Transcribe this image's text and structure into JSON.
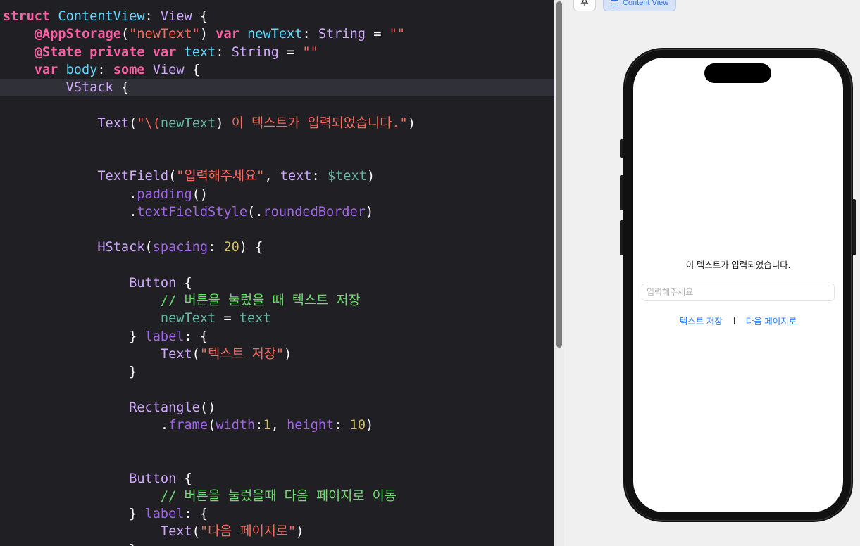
{
  "editor": {
    "lines": [
      [
        [
          "kw",
          "struct"
        ],
        [
          "p",
          " "
        ],
        [
          "def",
          "ContentView"
        ],
        [
          "p",
          ": "
        ],
        [
          "typ",
          "View"
        ],
        [
          "p",
          " {"
        ]
      ],
      [
        [
          "p",
          "    "
        ],
        [
          "kw",
          "@AppStorage"
        ],
        [
          "p",
          "("
        ],
        [
          "str",
          "\"newText\""
        ],
        [
          "p",
          ") "
        ],
        [
          "kw",
          "var"
        ],
        [
          "p",
          " "
        ],
        [
          "def",
          "newText"
        ],
        [
          "p",
          ": "
        ],
        [
          "typ",
          "String"
        ],
        [
          "p",
          " = "
        ],
        [
          "str",
          "\"\""
        ]
      ],
      [
        [
          "p",
          "    "
        ],
        [
          "kw",
          "@State"
        ],
        [
          "p",
          " "
        ],
        [
          "kw",
          "private"
        ],
        [
          "p",
          " "
        ],
        [
          "kw",
          "var"
        ],
        [
          "p",
          " "
        ],
        [
          "def",
          "text"
        ],
        [
          "p",
          ": "
        ],
        [
          "typ",
          "String"
        ],
        [
          "p",
          " = "
        ],
        [
          "str",
          "\"\""
        ]
      ],
      [
        [
          "p",
          "    "
        ],
        [
          "kw",
          "var"
        ],
        [
          "p",
          " "
        ],
        [
          "def",
          "body"
        ],
        [
          "p",
          ": "
        ],
        [
          "kw",
          "some"
        ],
        [
          "p",
          " "
        ],
        [
          "typ",
          "View"
        ],
        [
          "p",
          " {"
        ]
      ],
      [
        [
          "p",
          "        "
        ],
        [
          "typ",
          "VStack"
        ],
        [
          "p",
          " {"
        ]
      ],
      [],
      [
        [
          "p",
          "            "
        ],
        [
          "typ",
          "Text"
        ],
        [
          "p",
          "("
        ],
        [
          "str",
          "\"\\("
        ],
        [
          "var",
          "newText"
        ],
        [
          "p",
          ")"
        ],
        [
          "str",
          " 이 텍스트가 입력되었습니다.\""
        ],
        [
          "p",
          ")"
        ]
      ],
      [],
      [],
      [
        [
          "p",
          "            "
        ],
        [
          "typ",
          "TextField"
        ],
        [
          "p",
          "("
        ],
        [
          "str",
          "\"입력해주세요\""
        ],
        [
          "p",
          ", "
        ],
        [
          "typ",
          "text"
        ],
        [
          "p",
          ": "
        ],
        [
          "var",
          "$text"
        ],
        [
          "p",
          ")"
        ]
      ],
      [
        [
          "p",
          "                ."
        ],
        [
          "mth",
          "padding"
        ],
        [
          "p",
          "()"
        ]
      ],
      [
        [
          "p",
          "                ."
        ],
        [
          "mth",
          "textFieldStyle"
        ],
        [
          "p",
          "(."
        ],
        [
          "mth",
          "roundedBorder"
        ],
        [
          "p",
          ")"
        ]
      ],
      [],
      [
        [
          "p",
          "            "
        ],
        [
          "typ",
          "HStack"
        ],
        [
          "p",
          "("
        ],
        [
          "mth",
          "spacing"
        ],
        [
          "p",
          ": "
        ],
        [
          "num",
          "20"
        ],
        [
          "p",
          ") {"
        ]
      ],
      [],
      [
        [
          "p",
          "                "
        ],
        [
          "typ",
          "Button"
        ],
        [
          "p",
          " {"
        ]
      ],
      [
        [
          "p",
          "                    "
        ],
        [
          "cmt",
          "// 버튼을 눌렀을 때 텍스트 저장"
        ]
      ],
      [
        [
          "p",
          "                    "
        ],
        [
          "var",
          "newText"
        ],
        [
          "p",
          " = "
        ],
        [
          "var",
          "text"
        ]
      ],
      [
        [
          "p",
          "                } "
        ],
        [
          "mth",
          "label"
        ],
        [
          "p",
          ": {"
        ]
      ],
      [
        [
          "p",
          "                    "
        ],
        [
          "typ",
          "Text"
        ],
        [
          "p",
          "("
        ],
        [
          "str",
          "\"텍스트 저장\""
        ],
        [
          "p",
          ")"
        ]
      ],
      [
        [
          "p",
          "                }"
        ]
      ],
      [],
      [
        [
          "p",
          "                "
        ],
        [
          "typ",
          "Rectangle"
        ],
        [
          "p",
          "()"
        ]
      ],
      [
        [
          "p",
          "                    ."
        ],
        [
          "mth",
          "frame"
        ],
        [
          "p",
          "("
        ],
        [
          "mth",
          "width"
        ],
        [
          "p",
          ":"
        ],
        [
          "num",
          "1"
        ],
        [
          "p",
          ", "
        ],
        [
          "mth",
          "height"
        ],
        [
          "p",
          ": "
        ],
        [
          "num",
          "10"
        ],
        [
          "p",
          ")"
        ]
      ],
      [],
      [],
      [
        [
          "p",
          "                "
        ],
        [
          "typ",
          "Button"
        ],
        [
          "p",
          " {"
        ]
      ],
      [
        [
          "p",
          "                    "
        ],
        [
          "cmt",
          "// 버튼을 눌렀을때 다음 페이지로 이동"
        ]
      ],
      [
        [
          "p",
          "                } "
        ],
        [
          "mth",
          "label"
        ],
        [
          "p",
          ": {"
        ]
      ],
      [
        [
          "p",
          "                    "
        ],
        [
          "typ",
          "Text"
        ],
        [
          "p",
          "("
        ],
        [
          "str",
          "\"다음 페이지로\""
        ],
        [
          "p",
          ")"
        ]
      ],
      [
        [
          "p",
          "                }"
        ]
      ]
    ]
  },
  "canvas": {
    "pin_icon": "pin-icon",
    "tab_label": "Content View"
  },
  "preview": {
    "saved_text": "이 텍스트가 입력되었습니다.",
    "text_field_placeholder": "입력해주세요",
    "save_button_label": "텍스트 저장",
    "next_button_label": "다음 페이지로"
  }
}
